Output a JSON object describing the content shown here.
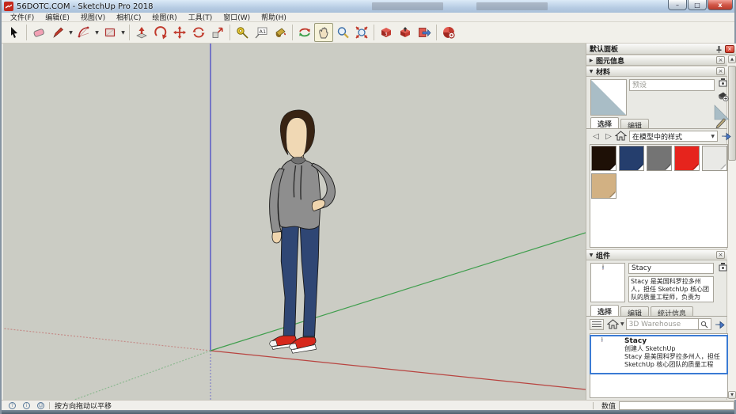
{
  "window": {
    "title": "56DOTC.COM - SketchUp Pro 2018",
    "controls": {
      "minimize": "–",
      "maximize": "□",
      "close": "x"
    }
  },
  "menu": {
    "items": [
      "文件(F)",
      "编辑(E)",
      "视图(V)",
      "相机(C)",
      "绘图(R)",
      "工具(T)",
      "窗口(W)",
      "帮助(H)"
    ]
  },
  "toolbar": {
    "tools": [
      "select",
      "eraser",
      "line",
      "arc",
      "rectangle",
      "push-pull",
      "follow-me",
      "move",
      "rotate",
      "scale",
      "tape-measure",
      "text",
      "paint-bucket",
      "orbit",
      "pan",
      "zoom",
      "zoom-extents",
      "get-models",
      "share-model",
      "send-to-layout",
      "extension-warehouse"
    ],
    "active_tool": "pan"
  },
  "viewport": {
    "figure": "stacy-person",
    "axis_colors": {
      "red": "#b84440",
      "green": "#3f9e4d",
      "blue": "#3c3cc8"
    },
    "background": "#cbccc4"
  },
  "panel": {
    "title": "默认面板",
    "entity_info": {
      "title": "图元信息"
    },
    "materials": {
      "title": "材料",
      "name_placeholder": "预设",
      "tabs": [
        "选择",
        "编辑"
      ],
      "dropdown_value": "在模型中的样式",
      "back_arrow": "◁",
      "forward_arrow": "▷",
      "swatches": [
        {
          "name": "dark-brown",
          "color": "#1e1006"
        },
        {
          "name": "navy-blue",
          "color": "#253e6d"
        },
        {
          "name": "gray",
          "color": "#747474"
        },
        {
          "name": "red",
          "color": "#e6241d"
        },
        {
          "name": "light-gray",
          "color": "#e9e9e6"
        },
        {
          "name": "tan",
          "color": "#d2b183"
        }
      ]
    },
    "components": {
      "title": "组件",
      "name_value": "Stacy",
      "description": "Stacy 是美国科罗拉多州人，担任 SketchUp 核心团队的质量工程师，负责为 SketchUp",
      "tabs": [
        "选择",
        "编辑",
        "统计信息"
      ],
      "search_placeholder": "3D Warehouse",
      "list": [
        {
          "name": "Stacy",
          "creator": "创建人 SketchUp",
          "description": "Stacy 是美国科罗拉多州人，担任 SketchUp 核心团队的质量工程师..."
        }
      ]
    }
  },
  "statusbar": {
    "hint": "按方向拖动以平移",
    "measurement_label": "数值",
    "measurement_value": ""
  }
}
